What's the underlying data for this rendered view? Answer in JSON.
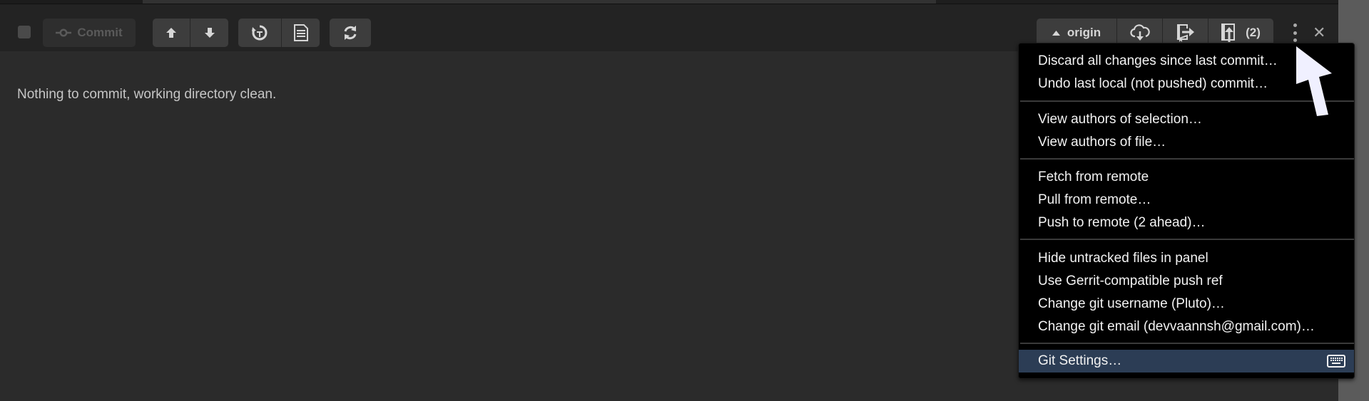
{
  "toolbar": {
    "commit_label": "Commit",
    "remote_label": "origin",
    "push_count": "(2)"
  },
  "main": {
    "status_message": "Nothing to commit, working directory clean."
  },
  "menu": {
    "groups": [
      [
        "Discard all changes since last commit…",
        "Undo last local (not pushed) commit…"
      ],
      [
        "View authors of selection…",
        "View authors of file…"
      ],
      [
        "Fetch from remote",
        "Pull from remote…",
        "Push to remote (2 ahead)…"
      ],
      [
        "Hide untracked files in panel",
        "Use Gerrit-compatible push ref",
        "Change git username (Pluto)…",
        "Change git email (devvaannsh@gmail.com)…"
      ],
      [
        "Git Settings…"
      ]
    ],
    "selected_item": "Git Settings…"
  },
  "colors": {
    "menu_bg": "#000000",
    "selected_bg": "#2c3d55",
    "toolbar_bg": "#232323",
    "panel_bg": "#2b2b2b"
  }
}
